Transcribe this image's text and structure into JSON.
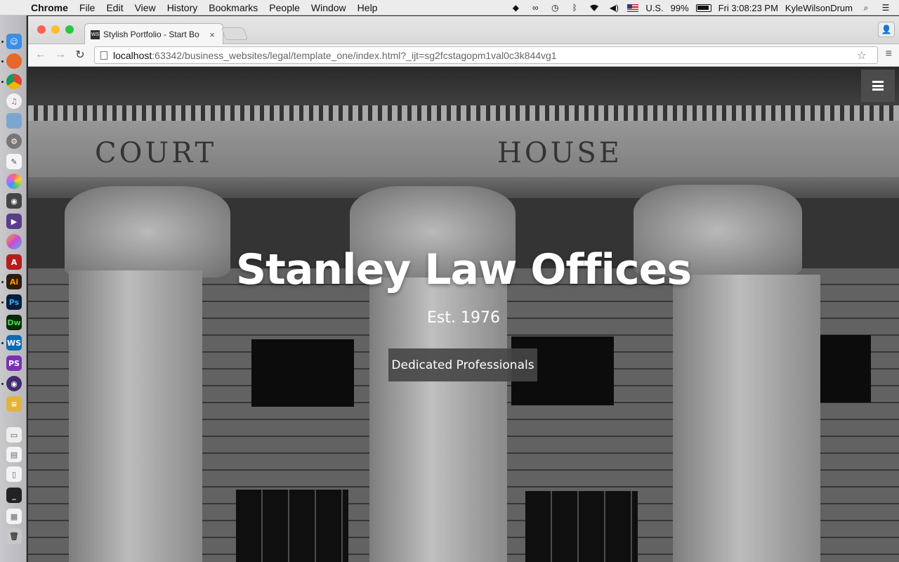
{
  "menubar": {
    "app": "Chrome",
    "menus": [
      "File",
      "Edit",
      "View",
      "History",
      "Bookmarks",
      "People",
      "Window",
      "Help"
    ],
    "input_source": "U.S.",
    "battery": "99%",
    "clock": "Fri 3:08:23 PM",
    "user": "KyleWilsonDrum"
  },
  "browser": {
    "tab_title": "Stylish Portfolio - Start Bo",
    "tab_favicon": "WS",
    "url_host": "localhost",
    "url_rest": ":63342/business_websites/legal/template_one/index.html?_ijt=sg2fcstagopm1val0c3k844vg1"
  },
  "page": {
    "inscription_left": "COURT",
    "inscription_right": "HOUSE",
    "hero_title": "Stanley Law Offices",
    "hero_subtitle": "Est. 1976",
    "hero_button": "Dedicated Professionals"
  },
  "dock": {
    "apps": [
      "finder-icon",
      "firefox-icon",
      "chrome-icon",
      "itunes-icon",
      "preview-icon",
      "system-preferences-icon",
      "textedit-icon",
      "photos-icon",
      "disk-utility-icon",
      "final-cut-icon",
      "sketch-icon",
      "acrobat-icon",
      "illustrator-icon",
      "photoshop-icon",
      "dreamweaver-icon",
      "webstorm-icon",
      "phpstorm-icon",
      "github-icon",
      "stacks-icon",
      "window-icon",
      "document-icon",
      "phone-icon",
      "terminal-icon",
      "file-icon",
      "trash-icon"
    ]
  }
}
